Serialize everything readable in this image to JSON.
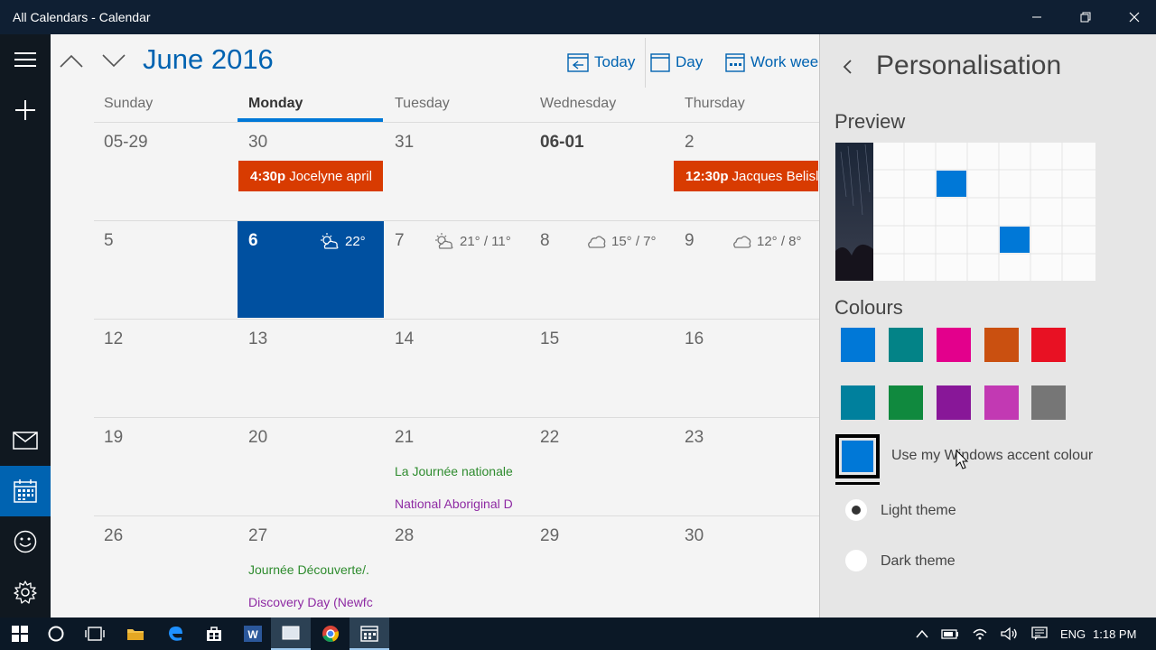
{
  "window": {
    "title": "All Calendars - Calendar"
  },
  "nav": {
    "items": [
      {
        "name": "hamburger-menu-icon"
      },
      {
        "name": "new-event-icon"
      },
      {
        "name": "mail-icon"
      },
      {
        "name": "calendar-icon"
      },
      {
        "name": "people-icon"
      },
      {
        "name": "settings-icon"
      }
    ]
  },
  "header": {
    "month": "June 2016",
    "today_label": "Today",
    "day_label": "Day",
    "work_week_label": "Work wee"
  },
  "days": [
    "Sunday",
    "Monday",
    "Tuesday",
    "Wednesday",
    "Thursday"
  ],
  "weeks": [
    [
      "05-29",
      "30",
      "31",
      "06-01",
      "2"
    ],
    [
      "5",
      "6",
      "7",
      "8",
      "9"
    ],
    [
      "12",
      "13",
      "14",
      "15",
      "16"
    ],
    [
      "19",
      "20",
      "21",
      "22",
      "23"
    ],
    [
      "26",
      "27",
      "28",
      "29",
      "30"
    ]
  ],
  "events": {
    "monday_530": {
      "time": "4:30p",
      "title": "Jocelyne april"
    },
    "thursday_602": {
      "time": "12:30p",
      "title": "Jacques Belisl"
    },
    "june21_1": "La Journée nationale",
    "june21_2": "National Aboriginal D",
    "june27_1": "Journée Découverte/.",
    "june27_2": "Discovery Day (Newfc"
  },
  "weather": {
    "june6": "22°",
    "june7": "21° / 11°",
    "june8": "15° / 7°",
    "june9": "12° / 8°"
  },
  "panel": {
    "title": "Personalisation",
    "preview_label": "Preview",
    "colours_label": "Colours",
    "accent_option": "Use my Windows accent colour",
    "light_theme": "Light theme",
    "dark_theme": "Dark theme",
    "selected_theme": "Light theme",
    "swatches_row1": [
      "#0078d7",
      "#038387",
      "#e3008c",
      "#ca5010",
      "#e81123"
    ],
    "swatches_row2": [
      "#00809d",
      "#10893e",
      "#881798",
      "#c239b3",
      "#767676"
    ],
    "accent_color": "#0078d7"
  },
  "taskbar": {
    "language": "ENG",
    "time": "1:18 PM"
  },
  "colors": {
    "accent": "#0063b1",
    "event_orange": "#d83b01",
    "today_blue": "#0050a0",
    "event_green": "#2e8b2e",
    "event_purple": "#8e2aa3"
  }
}
